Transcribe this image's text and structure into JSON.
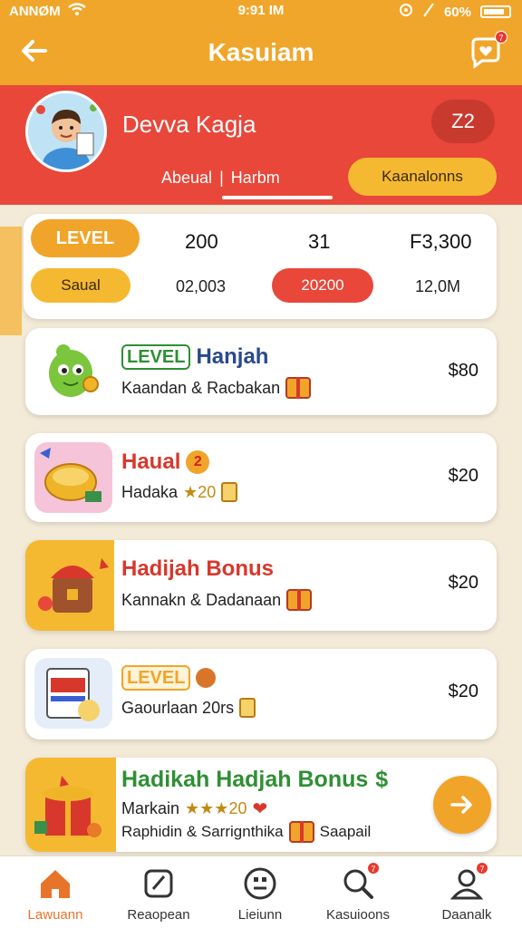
{
  "status_bar": {
    "carrier": "ANNØM",
    "time": "9:91 IM",
    "battery": "60%"
  },
  "header": {
    "title": "Kasuiam",
    "chat_badge": "7"
  },
  "profile": {
    "name": "Devva Kagja",
    "badge": "Z2",
    "tabs": [
      "Abeual",
      "|",
      "Harbm"
    ],
    "action_label": "Kaanalonns"
  },
  "stats": {
    "row1": {
      "pill": "LEVEL",
      "values": [
        "200",
        "31",
        "F3,300"
      ]
    },
    "row2": {
      "pill": "Saual",
      "values": [
        "02,003",
        "20200",
        "12,0M"
      ]
    }
  },
  "items": [
    {
      "tag": "LEVEL",
      "title": "Hanjah",
      "subtitle": "Kaandan & Racbakan",
      "price": "$80"
    },
    {
      "title": "Haual",
      "title_badge": "2",
      "subtitle": "Hadaka",
      "subtitle_extra": "★20",
      "price": "$20"
    },
    {
      "title": "Hadijah Bonus",
      "subtitle": "Kannakn & Dadanaan",
      "price": "$20"
    },
    {
      "tag": "LEVEL",
      "subtitle": "Gaourlaan 20rs",
      "price": "$20"
    },
    {
      "title": "Hadikah Hadjah Bonus",
      "title_suffix": "$",
      "line2": "Markain",
      "line2_extra": "★★★20",
      "line3": "Raphidin & Sarrignthika",
      "line3_extra": "Saapail"
    }
  ],
  "bottom_nav": [
    {
      "label": "Lawuann",
      "icon": "home-icon",
      "active": true
    },
    {
      "label": "Reaopean",
      "icon": "edit-icon"
    },
    {
      "label": "Lieiunn",
      "icon": "grid-icon"
    },
    {
      "label": "Kasuioons",
      "icon": "search-icon",
      "badge": "7"
    },
    {
      "label": "Daanalk",
      "icon": "profile-icon",
      "badge": "7"
    }
  ],
  "colors": {
    "header": "#f0a62b",
    "profile": "#e8473a",
    "accent": "#f5b931",
    "active_nav": "#e8742a"
  }
}
